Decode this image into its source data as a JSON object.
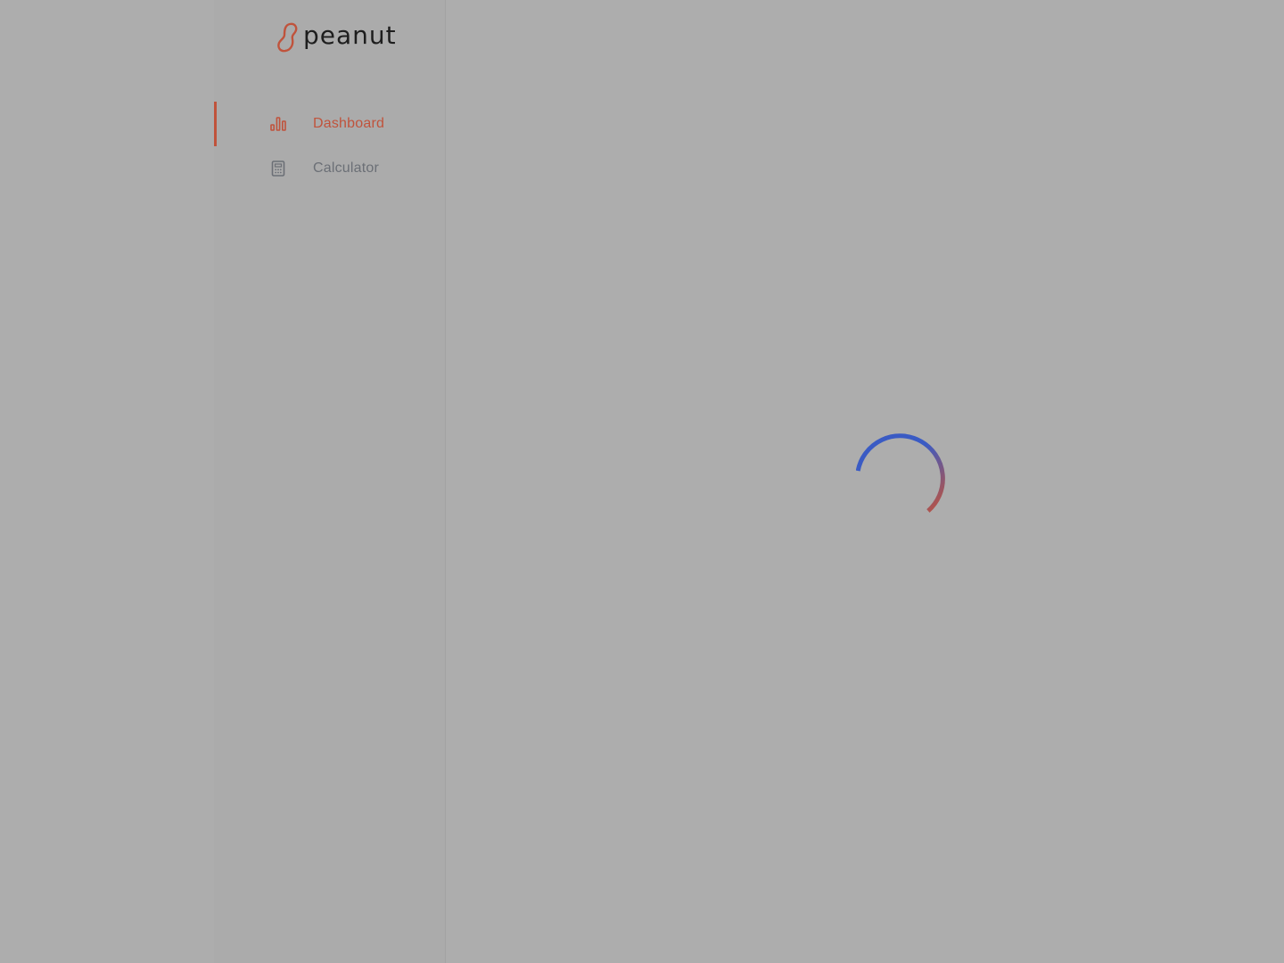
{
  "app": {
    "logo_text": "peanut",
    "brand_color": "#c0533c"
  },
  "sidebar": {
    "items": [
      {
        "label": "Dashboard",
        "icon": "bar-chart-icon",
        "active": true
      },
      {
        "label": "Calculator",
        "icon": "calculator-icon",
        "active": false
      }
    ]
  },
  "main": {
    "state": "loading",
    "spinner_colors": [
      "#3a5bc4",
      "#c0533c"
    ]
  }
}
